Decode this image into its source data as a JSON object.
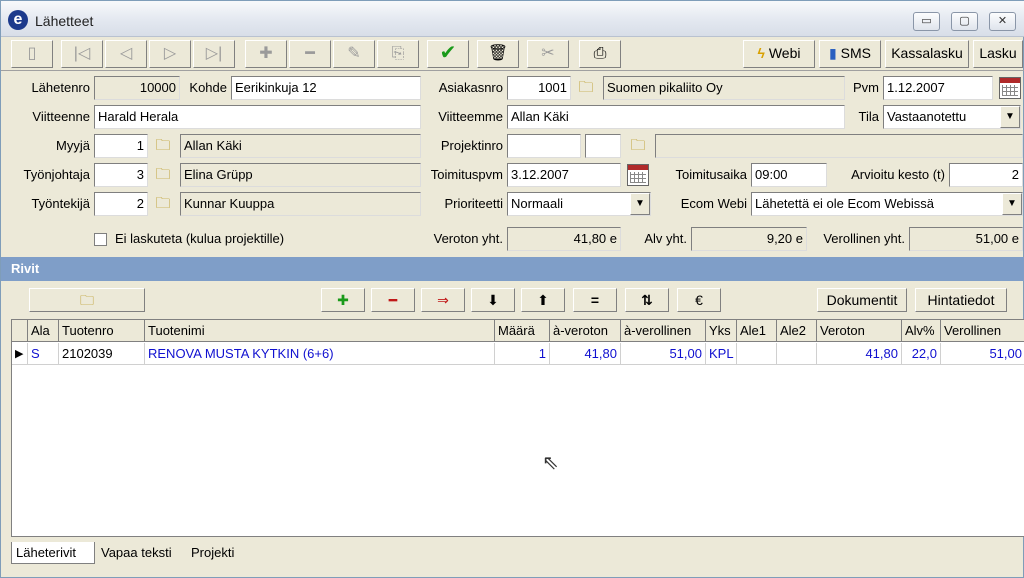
{
  "window": {
    "title": "Lähetteet",
    "logo": "e",
    "controls": [
      "▭",
      "▢",
      "✕"
    ]
  },
  "toolbar": {
    "webi": "Webi",
    "sms": "SMS",
    "kassalasku": "Kassalasku",
    "lasku": "Lasku",
    "icons": [
      "document-icon",
      "first-icon",
      "prev-icon",
      "next-icon",
      "last-icon",
      "add-icon",
      "remove-icon",
      "edit-icon",
      "export-icon",
      "confirm-icon",
      "delete-icon",
      "attach-icon",
      "print-icon"
    ]
  },
  "form": {
    "lahetenro_label": "Lähetenro",
    "lahetenro": "10000",
    "kohde_label": "Kohde",
    "kohde": "Eerikinkuja 12",
    "asiakasnro_label": "Asiakasnro",
    "asiakasnro": "1001",
    "asiakas_nimi": "Suomen pikaliito Oy",
    "pvm_label": "Pvm",
    "pvm": "1.12.2007",
    "viitteenne_label": "Viitteenne",
    "viitteenne": "Harald Herala",
    "viitteemme_label": "Viitteemme",
    "viitteemme": "Allan Käki",
    "tila_label": "Tila",
    "tila": "Vastaanotettu",
    "myyja_label": "Myyjä",
    "myyja_nro": "1",
    "myyja_nimi": "Allan Käki",
    "projektinro_label": "Projektinro",
    "projektinro": "",
    "tyonjohtaja_label": "Työnjohtaja",
    "tyonjohtaja_nro": "3",
    "tyonjohtaja_nimi": "Elina Grüpp",
    "toimituspvm_label": "Toimituspvm",
    "toimituspvm": "3.12.2007",
    "toimitusaika_label": "Toimitusaika",
    "toimitusaika": "09:00",
    "arvioitu_kesto_label": "Arvioitu kesto (t)",
    "arvioitu_kesto": "2",
    "tyontekija_label": "Työntekijä",
    "tyontekija_nro": "2",
    "tyontekija_nimi": "Kunnar Kuuppa",
    "prioriteetti_label": "Prioriteetti",
    "prioriteetti": "Normaali",
    "ecom_webi_label": "Ecom Webi",
    "ecom_webi": "Lähetettä ei ole Ecom Webissä",
    "ei_laskuteta_label": "Ei laskuteta (kulua projektille)",
    "ei_laskuteta_checked": false,
    "veroton_label": "Veroton yht.",
    "veroton": "41,80 e",
    "alv_label": "Alv yht.",
    "alv": "9,20 e",
    "verollinen_label": "Verollinen yht.",
    "verollinen": "51,00 e"
  },
  "section": {
    "title": "Rivit"
  },
  "lines_toolbar": {
    "dokumentit": "Dokumentit",
    "hintatiedot": "Hintatiedot",
    "equals": "=",
    "euro": "€"
  },
  "grid": {
    "columns": [
      "Ala",
      "Tuotenro",
      "Tuotenimi",
      "Määrä",
      "à-veroton",
      "à-verollinen",
      "Yks",
      "Ale1",
      "Ale2",
      "Veroton",
      "Alv%",
      "Verollinen"
    ],
    "rows": [
      {
        "ala": "S",
        "tuotenro": "2102039",
        "tuotenimi": "RENOVA MUSTA KYTKIN (6+6)",
        "maara": "1",
        "a_veroton": "41,80",
        "a_verollinen": "51,00",
        "yks": "KPL",
        "ale1": "",
        "ale2": "",
        "veroton": "41,80",
        "alv": "22,0",
        "verollinen": "51,00"
      }
    ]
  },
  "tabs": [
    "Läheterivit",
    "Vapaa teksti",
    "Projekti"
  ]
}
